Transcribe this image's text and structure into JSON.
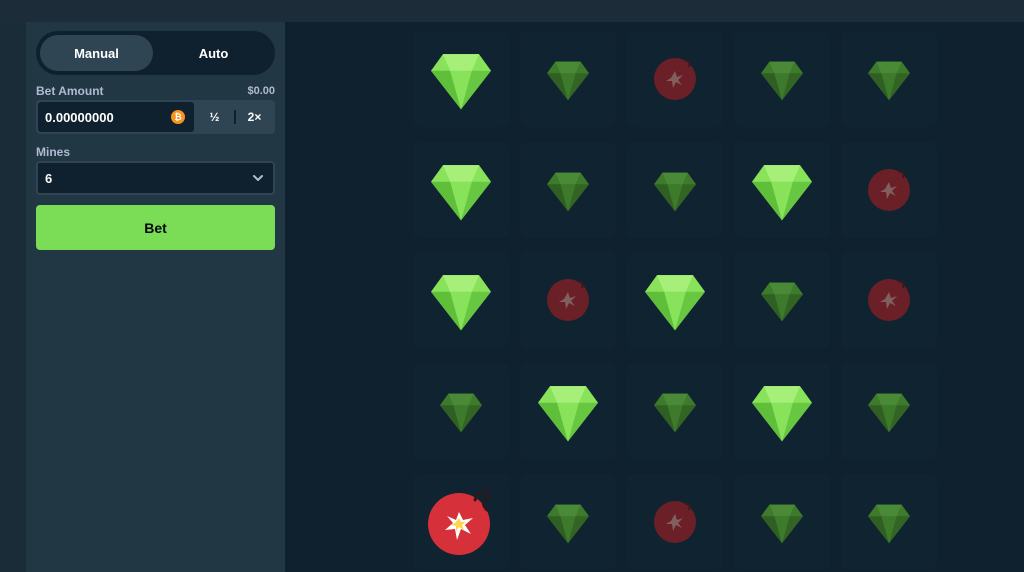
{
  "controls": {
    "tabs": {
      "manual_label": "Manual",
      "auto_label": "Auto"
    },
    "bet_amount": {
      "label": "Bet Amount",
      "usd_value": "$0.00",
      "value": "0.00000000",
      "currency_icon": "bitcoin-icon",
      "half_label": "½",
      "double_label": "2×"
    },
    "mines": {
      "label": "Mines",
      "selected_value": "6"
    },
    "bet_button_label": "Bet"
  },
  "colors": {
    "accent_green": "#7bdd55",
    "gem_bright": "#88e35a",
    "gem_dim": "#3e7a2c",
    "mine_red": "#d6303a",
    "mine_dim": "#6b1f27",
    "tile_bg": "#0f2330",
    "sidebar_bg": "#213743"
  },
  "grid": {
    "rows": 5,
    "cols": 5,
    "tiles": [
      [
        "gem-revealed",
        "gem-dim",
        "mine-dim",
        "gem-dim",
        "gem-dim"
      ],
      [
        "gem-revealed",
        "gem-dim",
        "gem-dim",
        "gem-revealed",
        "mine-dim"
      ],
      [
        "gem-revealed",
        "mine-dim",
        "gem-revealed",
        "gem-dim",
        "mine-dim"
      ],
      [
        "gem-dim",
        "gem-revealed",
        "gem-dim",
        "gem-revealed",
        "gem-dim"
      ],
      [
        "mine-exploded",
        "gem-dim",
        "mine-dim",
        "gem-dim",
        "gem-dim"
      ]
    ]
  }
}
